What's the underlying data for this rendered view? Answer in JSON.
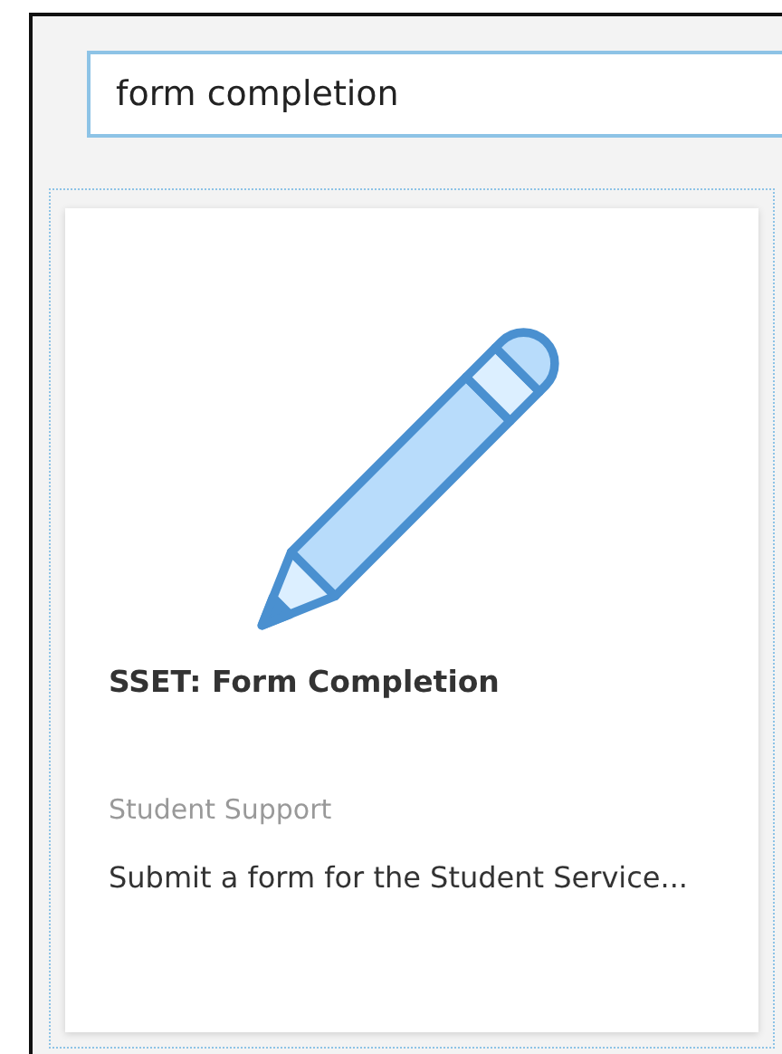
{
  "search": {
    "value": "form completion"
  },
  "results": [
    {
      "title": "SSET: Form Completion",
      "category": "Student Support",
      "description": "Submit a form for the Student Service..."
    }
  ]
}
